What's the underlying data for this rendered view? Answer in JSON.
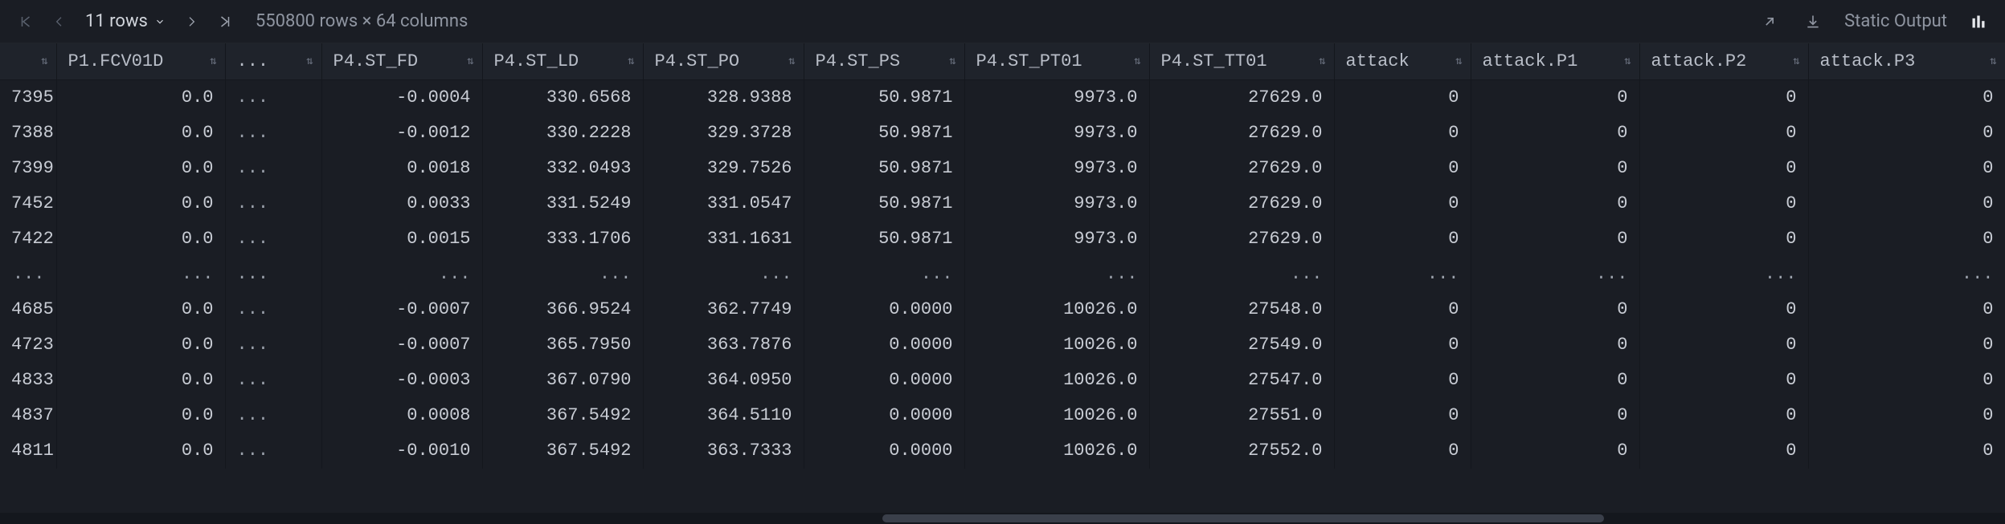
{
  "toolbar": {
    "rows_label": "11 rows",
    "dimensions": "550800 rows × 64 columns",
    "static_output": "Static Output"
  },
  "columns": [
    {
      "label": ""
    },
    {
      "label": "P1.FCV01D"
    },
    {
      "label": "..."
    },
    {
      "label": "P4.ST_FD"
    },
    {
      "label": "P4.ST_LD"
    },
    {
      "label": "P4.ST_PO"
    },
    {
      "label": "P4.ST_PS"
    },
    {
      "label": "P4.ST_PT01"
    },
    {
      "label": "P4.ST_TT01"
    },
    {
      "label": "attack"
    },
    {
      "label": "attack.P1"
    },
    {
      "label": "attack.P2"
    },
    {
      "label": "attack.P3"
    }
  ],
  "rows": [
    [
      "7395",
      "0.0",
      "...",
      "-0.0004",
      "330.6568",
      "328.9388",
      "50.9871",
      "9973.0",
      "27629.0",
      "0",
      "0",
      "0",
      "0"
    ],
    [
      "7388",
      "0.0",
      "...",
      "-0.0012",
      "330.2228",
      "329.3728",
      "50.9871",
      "9973.0",
      "27629.0",
      "0",
      "0",
      "0",
      "0"
    ],
    [
      "7399",
      "0.0",
      "...",
      "0.0018",
      "332.0493",
      "329.7526",
      "50.9871",
      "9973.0",
      "27629.0",
      "0",
      "0",
      "0",
      "0"
    ],
    [
      "7452",
      "0.0",
      "...",
      "0.0033",
      "331.5249",
      "331.0547",
      "50.9871",
      "9973.0",
      "27629.0",
      "0",
      "0",
      "0",
      "0"
    ],
    [
      "7422",
      "0.0",
      "...",
      "0.0015",
      "333.1706",
      "331.1631",
      "50.9871",
      "9973.0",
      "27629.0",
      "0",
      "0",
      "0",
      "0"
    ],
    [
      "...",
      "...",
      "...",
      "...",
      "...",
      "...",
      "...",
      "...",
      "...",
      "...",
      "...",
      "...",
      "..."
    ],
    [
      "4685",
      "0.0",
      "...",
      "-0.0007",
      "366.9524",
      "362.7749",
      "0.0000",
      "10026.0",
      "27548.0",
      "0",
      "0",
      "0",
      "0"
    ],
    [
      "4723",
      "0.0",
      "...",
      "-0.0007",
      "365.7950",
      "363.7876",
      "0.0000",
      "10026.0",
      "27549.0",
      "0",
      "0",
      "0",
      "0"
    ],
    [
      "4833",
      "0.0",
      "...",
      "-0.0003",
      "367.0790",
      "364.0950",
      "0.0000",
      "10026.0",
      "27547.0",
      "0",
      "0",
      "0",
      "0"
    ],
    [
      "4837",
      "0.0",
      "...",
      "0.0008",
      "367.5492",
      "364.5110",
      "0.0000",
      "10026.0",
      "27551.0",
      "0",
      "0",
      "0",
      "0"
    ],
    [
      "4811",
      "0.0",
      "...",
      "-0.0010",
      "367.5492",
      "363.7333",
      "0.0000",
      "10026.0",
      "27552.0",
      "0",
      "0",
      "0",
      "0"
    ]
  ]
}
